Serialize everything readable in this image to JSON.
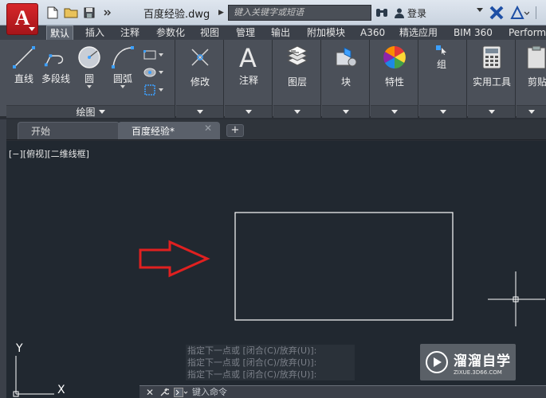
{
  "app": {
    "logo_letter": "A",
    "document_title": "百度经验.dwg",
    "search_placeholder": "键入关键字或短语",
    "login_label": "登录"
  },
  "ribbon_tabs": [
    {
      "label": "默认",
      "active": true
    },
    {
      "label": "插入"
    },
    {
      "label": "注释"
    },
    {
      "label": "参数化"
    },
    {
      "label": "视图"
    },
    {
      "label": "管理"
    },
    {
      "label": "输出"
    },
    {
      "label": "附加模块"
    },
    {
      "label": "A360"
    },
    {
      "label": "精选应用"
    },
    {
      "label": "BIM 360"
    },
    {
      "label": "Perform"
    }
  ],
  "ribbon": {
    "draw": {
      "line": "直线",
      "polyline": "多段线",
      "circle": "圆",
      "arc": "圆弧",
      "panel_label": "绘图"
    },
    "modify": "修改",
    "annotation": "注释",
    "layers": "图层",
    "block": "块",
    "properties": "特性",
    "groups": "组",
    "utilities": "实用工具",
    "clipboard": "剪贴"
  },
  "doc_tabs": {
    "start": "开始",
    "current": "百度经验*",
    "add": "+"
  },
  "viewport": {
    "label": "[−][俯视][二维线框]",
    "axis_y": "Y",
    "axis_x": "X"
  },
  "command_history": [
    "指定下一点或 [闭合(C)/放弃(U)]:",
    "指定下一点或 [闭合(C)/放弃(U)]:",
    "指定下一点或 [闭合(C)/放弃(U)]:"
  ],
  "command_line": {
    "placeholder": "键入命令"
  },
  "watermark": {
    "title": "溜溜自学",
    "url": "ZIXUE.3D66.COM"
  },
  "colors": {
    "canvas": "#212830",
    "ribbon": "#4b5059",
    "accent_red": "#d7262a",
    "annotation_arrow": "#e02020",
    "drawn_rectangle": "#ffffff"
  }
}
